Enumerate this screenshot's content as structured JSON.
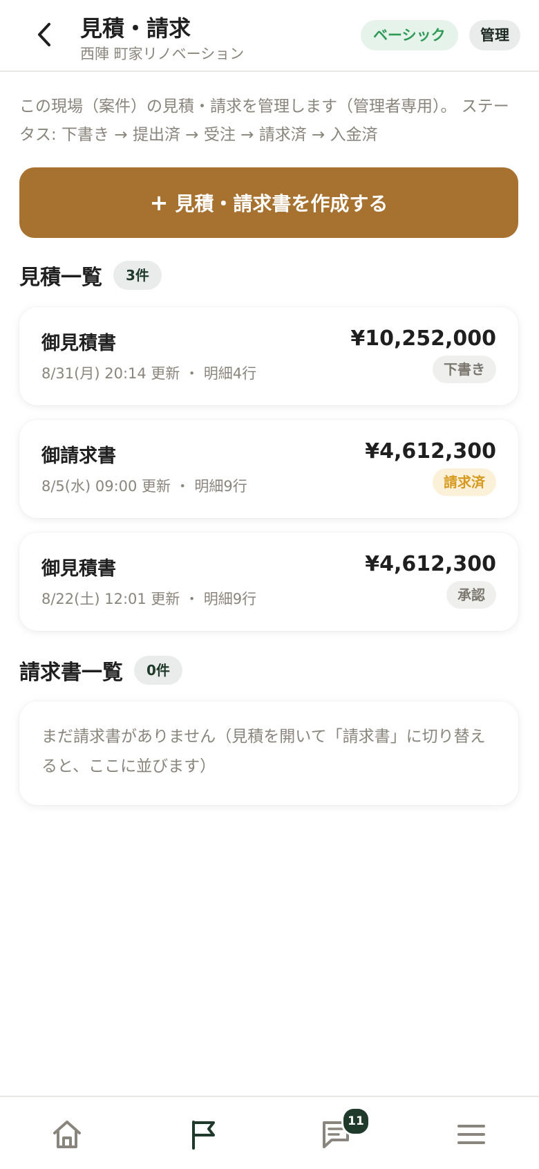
{
  "header": {
    "title": "見積・請求",
    "subtitle": "西陣 町家リノベーション",
    "plan_badge": "ベーシック",
    "role_badge": "管理"
  },
  "description": "この現場（案件）の見積・請求を管理します（管理者専用）。 ステータス: 下書き → 提出済 → 受注 → 請求済 → 入金済",
  "create_button": {
    "plus": "+",
    "label": "見積・請求書を作成する"
  },
  "estimates": {
    "title": "見積一覧",
    "count": "3件",
    "items": [
      {
        "title": "御見積書",
        "meta": "8/31(月) 20:14 更新 ・ 明細4行",
        "amount": "¥10,252,000",
        "status": "下書き"
      },
      {
        "title": "御請求書",
        "meta": "8/5(水) 09:00 更新 ・ 明細9行",
        "amount": "¥4,612,300",
        "status": "請求済"
      },
      {
        "title": "御見積書",
        "meta": "8/22(土) 12:01 更新 ・ 明細9行",
        "amount": "¥4,612,300",
        "status": "承認"
      }
    ]
  },
  "invoices": {
    "title": "請求書一覧",
    "count": "0件",
    "empty_text": "まだ請求書がありません（見積を開いて「請求書」に切り替えると、ここに並びます）"
  },
  "bottom_nav": {
    "home_icon": "home-icon",
    "flag_icon": "flag-icon",
    "chat_icon": "chat-icon",
    "chat_badge": "11",
    "menu_icon": "menu-icon"
  },
  "colors": {
    "accent": "#a7712f",
    "dark_green": "#1f3a2a",
    "muted_text": "#8a857c"
  }
}
